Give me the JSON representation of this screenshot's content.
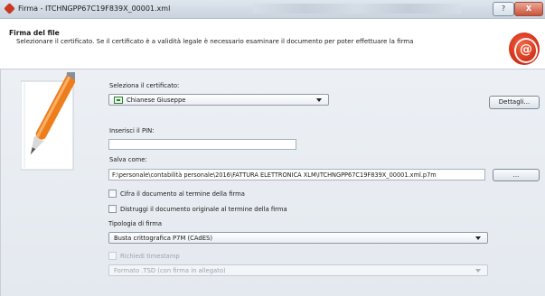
{
  "window": {
    "title": "Firma - ITCHNGPP67C19F839X_00001.xml",
    "help_label": "?",
    "close_label": "X"
  },
  "header": {
    "title": "Firma del file",
    "subtitle": "Selezionare il certificato. Se il certificato è a validità legale è necessario esaminare il documento per poter effettuare la firma",
    "seal_glyph": "@"
  },
  "form": {
    "cert_label": "Seleziona il certificato:",
    "cert_value": "Chianese Giuseppe",
    "details_button": "Dettagli...",
    "pin_label": "Inserisci il PIN:",
    "pin_value": "",
    "save_label": "Salva come:",
    "save_value": "F:\\personale\\contabilità personale\\2016\\FATTURA ELETTRONICA XLM\\ITCHNGPP67C19F839X_00001.xml.p7m",
    "browse_button": "...",
    "encrypt_label": "Cifra il documento al termine della firma",
    "destroy_label": "Distruggi il documento originale al termine della firma",
    "type_label": "Tipologia di firma",
    "type_value": "Busta crittografica P7M (CAdES)",
    "timestamp_label": "Richiedi timestamp",
    "timestamp_format_value": "Formato .TSD (con firma in allegato)"
  },
  "icons": {
    "app": "signature-app-icon",
    "seal": "red-seal-icon",
    "pen": "pen-icon"
  },
  "colors": {
    "accent_red": "#d8361f",
    "panel_bg": "#e8edf2"
  }
}
